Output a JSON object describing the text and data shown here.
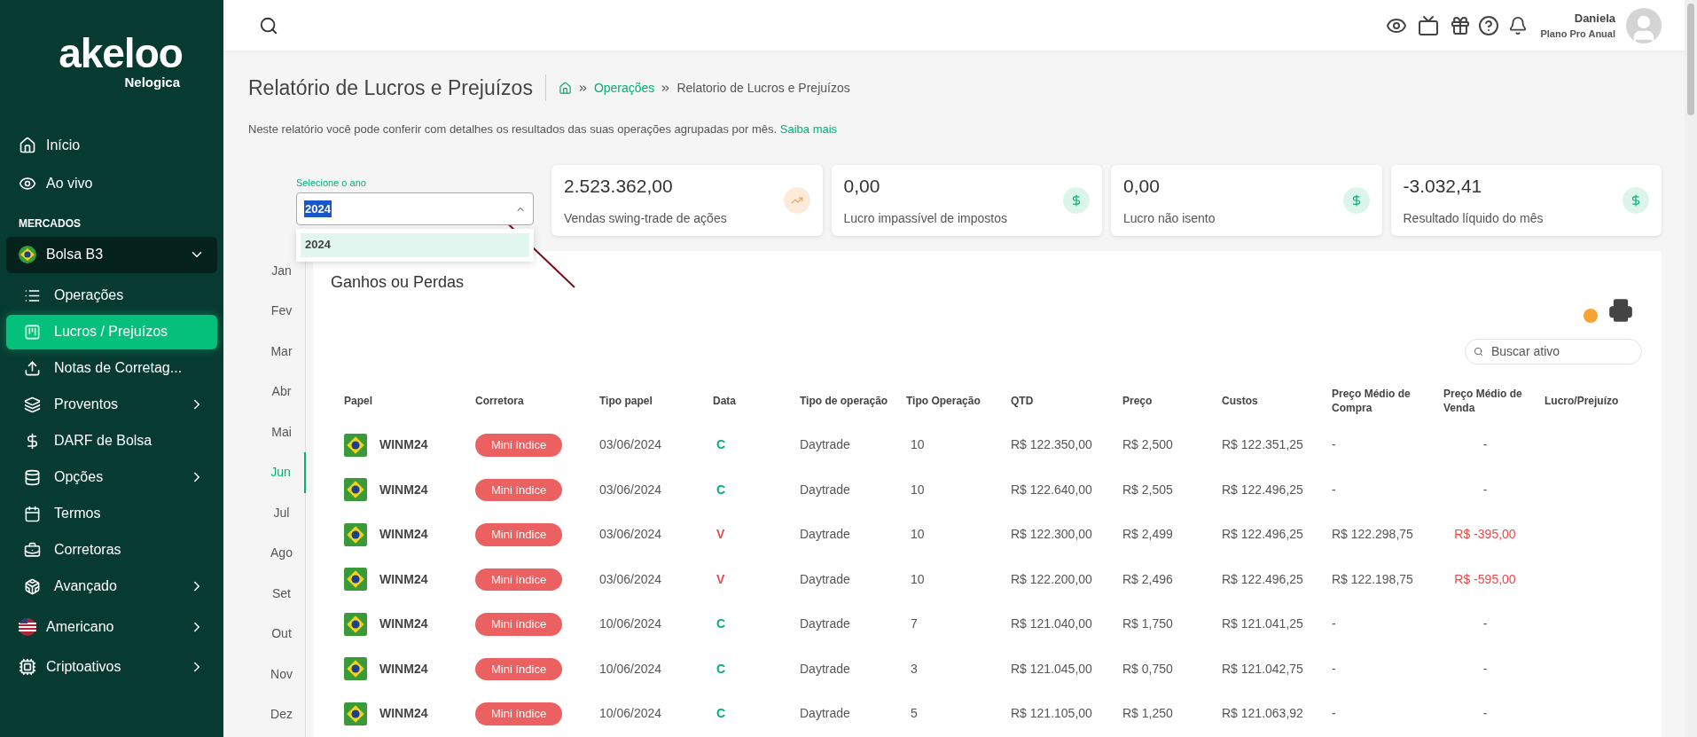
{
  "brand": {
    "name": "akeloo",
    "sub": "Nelogica"
  },
  "sidebar": [
    {
      "kind": "item",
      "label": "Início",
      "selected": false
    },
    {
      "kind": "item",
      "label": "Ao vivo",
      "selected": false
    },
    {
      "kind": "section",
      "label": "MERCADOS"
    },
    {
      "kind": "market",
      "label": "Bolsa B3",
      "expanded": true,
      "children": [
        {
          "label": "Operações",
          "selected": false,
          "arrow": false
        },
        {
          "label": "Lucros / Prejuízos",
          "selected": true,
          "arrow": false
        },
        {
          "label": "Notas de Corretag...",
          "selected": false,
          "arrow": false
        },
        {
          "label": "Proventos",
          "selected": false,
          "arrow": true
        },
        {
          "label": "DARF de Bolsa",
          "selected": false,
          "arrow": false
        },
        {
          "label": "Opções",
          "selected": false,
          "arrow": true
        },
        {
          "label": "Termos",
          "selected": false,
          "arrow": false
        },
        {
          "label": "Corretoras",
          "selected": false,
          "arrow": false
        },
        {
          "label": "Avançado",
          "selected": false,
          "arrow": true
        }
      ]
    },
    {
      "kind": "market",
      "label": "Americano",
      "expanded": false
    },
    {
      "kind": "market",
      "label": "Criptoativos",
      "expanded": false
    }
  ],
  "user": {
    "name": "Daniela",
    "plan": "Plano Pro Anual"
  },
  "page": {
    "title": "Relatório de Lucros e Prejuízos",
    "breadcrumb": [
      "Operações",
      "Relatorio de Lucros e Prejuízos"
    ],
    "description": "Neste relatório você pode conferir com detalhes os resultados das suas operações agrupadas por mês.",
    "link": "Saiba mais"
  },
  "year_select": {
    "label": "Selecione o ano",
    "value": "2024",
    "options": [
      {
        "label": "2024",
        "selected": true
      }
    ]
  },
  "cards": [
    {
      "value": "2.523.362,00",
      "label": "Vendas swing-trade de ações",
      "kind": "trend"
    },
    {
      "value": "0,00",
      "label": "Lucro impassível de impostos",
      "kind": "money"
    },
    {
      "value": "0,00",
      "label": "Lucro não isento",
      "kind": "money"
    },
    {
      "value": "-3.032,41",
      "label": "Resultado líquido do mês",
      "kind": "money"
    }
  ],
  "months": [
    {
      "label": "Jan",
      "selected": false
    },
    {
      "label": "Fev",
      "selected": false
    },
    {
      "label": "Mar",
      "selected": false
    },
    {
      "label": "Abr",
      "selected": false
    },
    {
      "label": "Mai",
      "selected": false
    },
    {
      "label": "Jun",
      "selected": true
    },
    {
      "label": "Jul",
      "selected": false
    },
    {
      "label": "Ago",
      "selected": false
    },
    {
      "label": "Set",
      "selected": false
    },
    {
      "label": "Out",
      "selected": false
    },
    {
      "label": "Nov",
      "selected": false
    },
    {
      "label": "Dez",
      "selected": false
    }
  ],
  "table": {
    "title": "Ganhos ou Perdas",
    "search_placeholder": "Buscar ativo",
    "columns": [
      "Papel",
      "Corretora",
      "Tipo papel",
      "Data",
      "Tipo de operação",
      "Tipo Operação",
      "QTD",
      "Preço",
      "Custos",
      "Preço Médio de Compra",
      "Preço Médio de Venda",
      "Lucro/Prejuízo"
    ],
    "rows": [
      {
        "papel": "WINM24",
        "corretora": "Mini índice",
        "tipo_papel": "03/06/2024",
        "data": "C",
        "kind": "buy",
        "tipo_operacao": "Daytrade",
        "qtd_col": "10",
        "qtd": "R$ 122.350,00",
        "preco": "R$ 2,500",
        "custos": "R$ 122.351,25",
        "pm_compra": "-",
        "pm_venda": "-"
      },
      {
        "papel": "WINM24",
        "corretora": "Mini índice",
        "tipo_papel": "03/06/2024",
        "data": "C",
        "kind": "buy",
        "tipo_operacao": "Daytrade",
        "qtd_col": "10",
        "qtd": "R$ 122.640,00",
        "preco": "R$ 2,505",
        "custos": "R$ 122.496,25",
        "pm_compra": "-",
        "pm_venda": "-"
      },
      {
        "papel": "WINM24",
        "corretora": "Mini índice",
        "tipo_papel": "03/06/2024",
        "data": "V",
        "kind": "sell",
        "tipo_operacao": "Daytrade",
        "qtd_col": "10",
        "qtd": "R$ 122.300,00",
        "preco": "R$ 2,499",
        "custos": "R$ 122.496,25",
        "pm_compra": "R$ 122.298,75",
        "pm_venda": "R$ -395,00"
      },
      {
        "papel": "WINM24",
        "corretora": "Mini índice",
        "tipo_papel": "03/06/2024",
        "data": "V",
        "kind": "sell",
        "tipo_operacao": "Daytrade",
        "qtd_col": "10",
        "qtd": "R$ 122.200,00",
        "preco": "R$ 2,496",
        "custos": "R$ 122.496,25",
        "pm_compra": "R$ 122.198,75",
        "pm_venda": "R$ -595,00"
      },
      {
        "papel": "WINM24",
        "corretora": "Mini índice",
        "tipo_papel": "10/06/2024",
        "data": "C",
        "kind": "buy",
        "tipo_operacao": "Daytrade",
        "qtd_col": "7",
        "qtd": "R$ 121.040,00",
        "preco": "R$ 1,750",
        "custos": "R$ 121.041,25",
        "pm_compra": "-",
        "pm_venda": "-"
      },
      {
        "papel": "WINM24",
        "corretora": "Mini índice",
        "tipo_papel": "10/06/2024",
        "data": "C",
        "kind": "buy",
        "tipo_operacao": "Daytrade",
        "qtd_col": "3",
        "qtd": "R$ 121.045,00",
        "preco": "R$ 0,750",
        "custos": "R$ 121.042,75",
        "pm_compra": "-",
        "pm_venda": "-"
      },
      {
        "papel": "WINM24",
        "corretora": "Mini índice",
        "tipo_papel": "10/06/2024",
        "data": "C",
        "kind": "buy",
        "tipo_operacao": "Daytrade",
        "qtd_col": "5",
        "qtd": "R$ 121.105,00",
        "preco": "R$ 1,250",
        "custos": "R$ 121.063,92",
        "pm_compra": "-",
        "pm_venda": "-"
      }
    ]
  }
}
